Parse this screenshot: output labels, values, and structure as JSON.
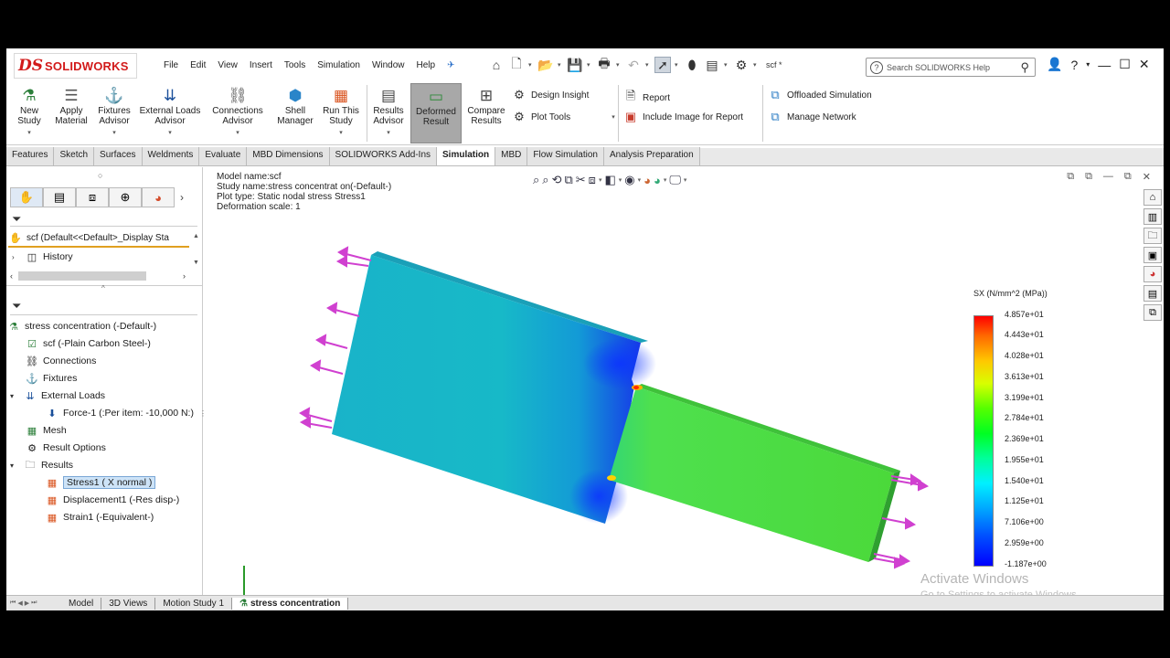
{
  "app": {
    "brand_ds": "DS",
    "brand_name": "SOLIDWORKS"
  },
  "menu": [
    "File",
    "Edit",
    "View",
    "Insert",
    "Tools",
    "Simulation",
    "Window",
    "Help"
  ],
  "quick": {
    "file_label": "scf *"
  },
  "search": {
    "placeholder": "Search SOLIDWORKS Help"
  },
  "ribbon": {
    "new_study": "New Study",
    "apply_material": "Apply Material",
    "fixtures": "Fixtures Advisor",
    "external_loads": "External Loads Advisor",
    "connections": "Connections Advisor",
    "shell_manager": "Shell Manager",
    "run_study": "Run This Study",
    "results_advisor": "Results Advisor",
    "deformed_result": "Deformed Result",
    "compare_results": "Compare Results",
    "design_insight": "Design Insight",
    "plot_tools": "Plot Tools",
    "report": "Report",
    "include_image": "Include Image for Report",
    "offloaded": "Offloaded Simulation",
    "manage_network": "Manage Network"
  },
  "command_tabs": [
    "Features",
    "Sketch",
    "Surfaces",
    "Weldments",
    "Evaluate",
    "MBD Dimensions",
    "SOLIDWORKS Add-Ins",
    "Simulation",
    "MBD",
    "Flow Simulation",
    "Analysis Preparation"
  ],
  "command_tabs_active": "Simulation",
  "feature_tree": {
    "root": "scf  (Default<<Default>_Display Sta",
    "history": "History"
  },
  "study_tree": {
    "study": "stress concentration (-Default-)",
    "part": "scf (-Plain Carbon Steel-)",
    "connections": "Connections",
    "fixtures": "Fixtures",
    "external_loads": "External Loads",
    "force": "Force-1 (:Per item: -10,000 N:)",
    "mesh": "Mesh",
    "result_options": "Result Options",
    "results": "Results",
    "stress": "Stress1 ( X normal )",
    "displacement": "Displacement1 (-Res disp-)",
    "strain": "Strain1 (-Equivalent-)"
  },
  "viewport": {
    "model_name": "Model name:scf",
    "study_name": "Study name:stress concentrat on(-Default-)",
    "plot_type": "Plot type: Static nodal stress Stress1",
    "deformation": "Deformation scale: 1"
  },
  "legend": {
    "title": "SX (N/mm^2 (MPa))",
    "ticks": [
      "4.857e+01",
      "4.443e+01",
      "4.028e+01",
      "3.613e+01",
      "3.199e+01",
      "2.784e+01",
      "2.369e+01",
      "1.955e+01",
      "1.540e+01",
      "1.125e+01",
      "7.106e+00",
      "2.959e+00",
      "-1.187e+00"
    ],
    "max_color": "#ff0000",
    "min_color": "#0000ff"
  },
  "watermark": {
    "line1": "Activate Windows",
    "line2": "Go to Settings to activate Windows."
  },
  "bottom_tabs": [
    "Model",
    "3D Views",
    "Motion Study 1",
    "stress concentration"
  ],
  "bottom_tabs_active": "stress concentration"
}
